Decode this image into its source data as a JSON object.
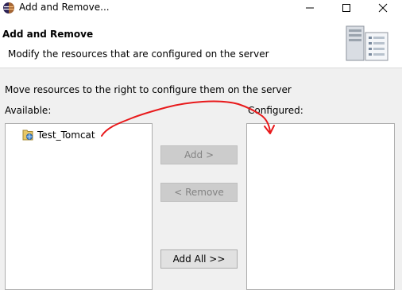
{
  "window": {
    "title": "Add and Remove...",
    "controls": [
      "minimize",
      "maximize",
      "close"
    ]
  },
  "header": {
    "title": "Add and Remove",
    "description": "Modify the resources that are configured on the server",
    "icon": "server-icon"
  },
  "instruction": "Move resources to the right to configure them on the server",
  "available": {
    "label": "Available:",
    "items": [
      {
        "label": "Test_Tomcat",
        "icon": "web-project-icon"
      }
    ]
  },
  "configured": {
    "label": "Configured:",
    "items": []
  },
  "buttons": {
    "add": {
      "label": "Add >",
      "enabled": false
    },
    "remove": {
      "label": "< Remove",
      "enabled": false
    },
    "add_all": {
      "label": "Add All >>",
      "enabled": true
    }
  },
  "annotation": {
    "color": "#e8191b",
    "kind": "hand-drawn-arrow"
  }
}
